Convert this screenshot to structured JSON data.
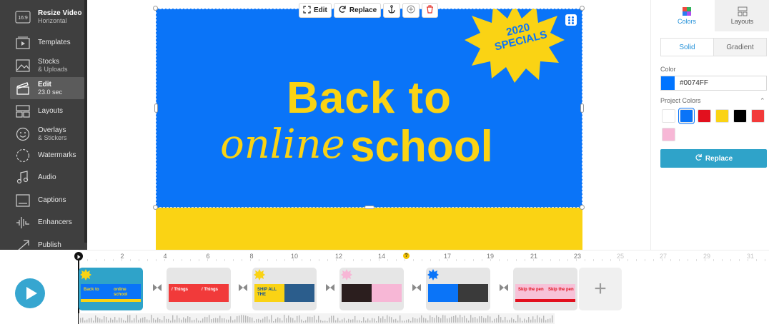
{
  "sidebar": {
    "items": [
      {
        "label": "Resize Video",
        "sub": "Horizontal",
        "icon": "aspect-ratio-icon",
        "badge": "16:9"
      },
      {
        "label": "Templates",
        "icon": "templates-icon"
      },
      {
        "label": "Stocks",
        "sub": "& Uploads",
        "icon": "image-icon"
      },
      {
        "label": "Edit",
        "sub": "23.0 sec",
        "icon": "clapperboard-icon",
        "active": true
      },
      {
        "label": "Layouts",
        "icon": "layouts-icon"
      },
      {
        "label": "Overlays",
        "sub": "& Stickers",
        "icon": "smiley-icon"
      },
      {
        "label": "Watermarks",
        "icon": "watermark-icon"
      },
      {
        "label": "Audio",
        "icon": "music-note-icon"
      },
      {
        "label": "Captions",
        "icon": "captions-icon"
      },
      {
        "label": "Enhancers",
        "icon": "waveform-icon"
      },
      {
        "label": "Publish",
        "icon": "share-icon"
      }
    ]
  },
  "toolbar": {
    "edit_label": "Edit",
    "replace_label": "Replace"
  },
  "canvas": {
    "headline_line1": "Back to",
    "headline_script": "online",
    "headline_word": "school",
    "burst_line1": "2020",
    "burst_line2": "SPECIALS",
    "colors": {
      "background": "#0A74F8",
      "accent": "#FAD314"
    }
  },
  "panel": {
    "tabs": {
      "colors": "Colors",
      "layouts": "Layouts"
    },
    "fill_modes": {
      "solid": "Solid",
      "gradient": "Gradient"
    },
    "color_label": "Color",
    "color_value": "#0074FF",
    "project_colors_label": "Project Colors",
    "project_colors": [
      "#FFFFFF",
      "#0A74F8",
      "#E2101E",
      "#FAD314",
      "#000000",
      "#F23A3A",
      "#F7B7D6"
    ],
    "selected_swatch": 1,
    "replace_label": "Replace"
  },
  "timeline": {
    "ticks": [
      "2",
      "4",
      "6",
      "8",
      "10",
      "12",
      "14",
      "17",
      "19",
      "21",
      "23",
      "25",
      "27",
      "29",
      "31"
    ],
    "dim_ticks_from": 11,
    "marker_label": "?",
    "clips": [
      {
        "title_a": "Back to",
        "title_b": "online school",
        "selected": true
      },
      {
        "title_a": "/ Things",
        "title_b": "/ Things"
      },
      {
        "title_a": "SHIP ALL THE",
        "title_b": ""
      },
      {
        "title_a": "",
        "title_b": ""
      },
      {
        "title_a": "",
        "title_b": ""
      },
      {
        "title_a": "Skip the pen",
        "title_b": "Skip the pen"
      }
    ],
    "add_label": "+"
  }
}
